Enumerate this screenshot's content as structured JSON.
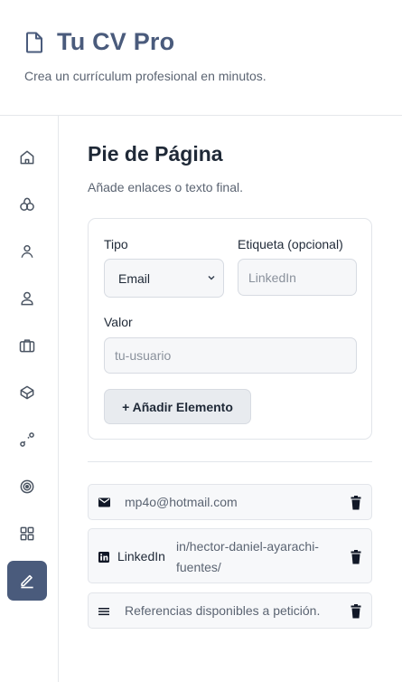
{
  "header": {
    "title": "Tu CV Pro",
    "tagline": "Crea un currículum profesional en minutos."
  },
  "sidebar": {
    "items": [
      {
        "icon": "home-icon",
        "active": false
      },
      {
        "icon": "pets-icon",
        "active": false
      },
      {
        "icon": "user-outline-icon",
        "active": false
      },
      {
        "icon": "user-icon",
        "active": false
      },
      {
        "icon": "briefcase-icon",
        "active": false
      },
      {
        "icon": "education-icon",
        "active": false
      },
      {
        "icon": "route-icon",
        "active": false
      },
      {
        "icon": "target-icon",
        "active": false
      },
      {
        "icon": "grid-icon",
        "active": false
      },
      {
        "icon": "edit-icon",
        "active": true
      }
    ],
    "active_color": "#4a5b7c"
  },
  "section": {
    "title": "Pie de Página",
    "subtitle": "Añade enlaces o texto final."
  },
  "form": {
    "type_label": "Tipo",
    "type_value": "Email",
    "tag_label": "Etiqueta (opcional)",
    "tag_placeholder": "LinkedIn",
    "value_label": "Valor",
    "value_placeholder": "tu-usuario",
    "add_button": "+ Añadir Elemento"
  },
  "items": [
    {
      "icon": "email-icon",
      "label": "",
      "text": "mp4o@hotmail.com"
    },
    {
      "icon": "linkedin-icon",
      "label": "LinkedIn",
      "text_line1": "in/hector-daniel-ayarachi-",
      "text_line2": "fuentes/"
    },
    {
      "icon": "text-lines-icon",
      "label": "",
      "text": "Referencias disponibles a petición."
    }
  ]
}
